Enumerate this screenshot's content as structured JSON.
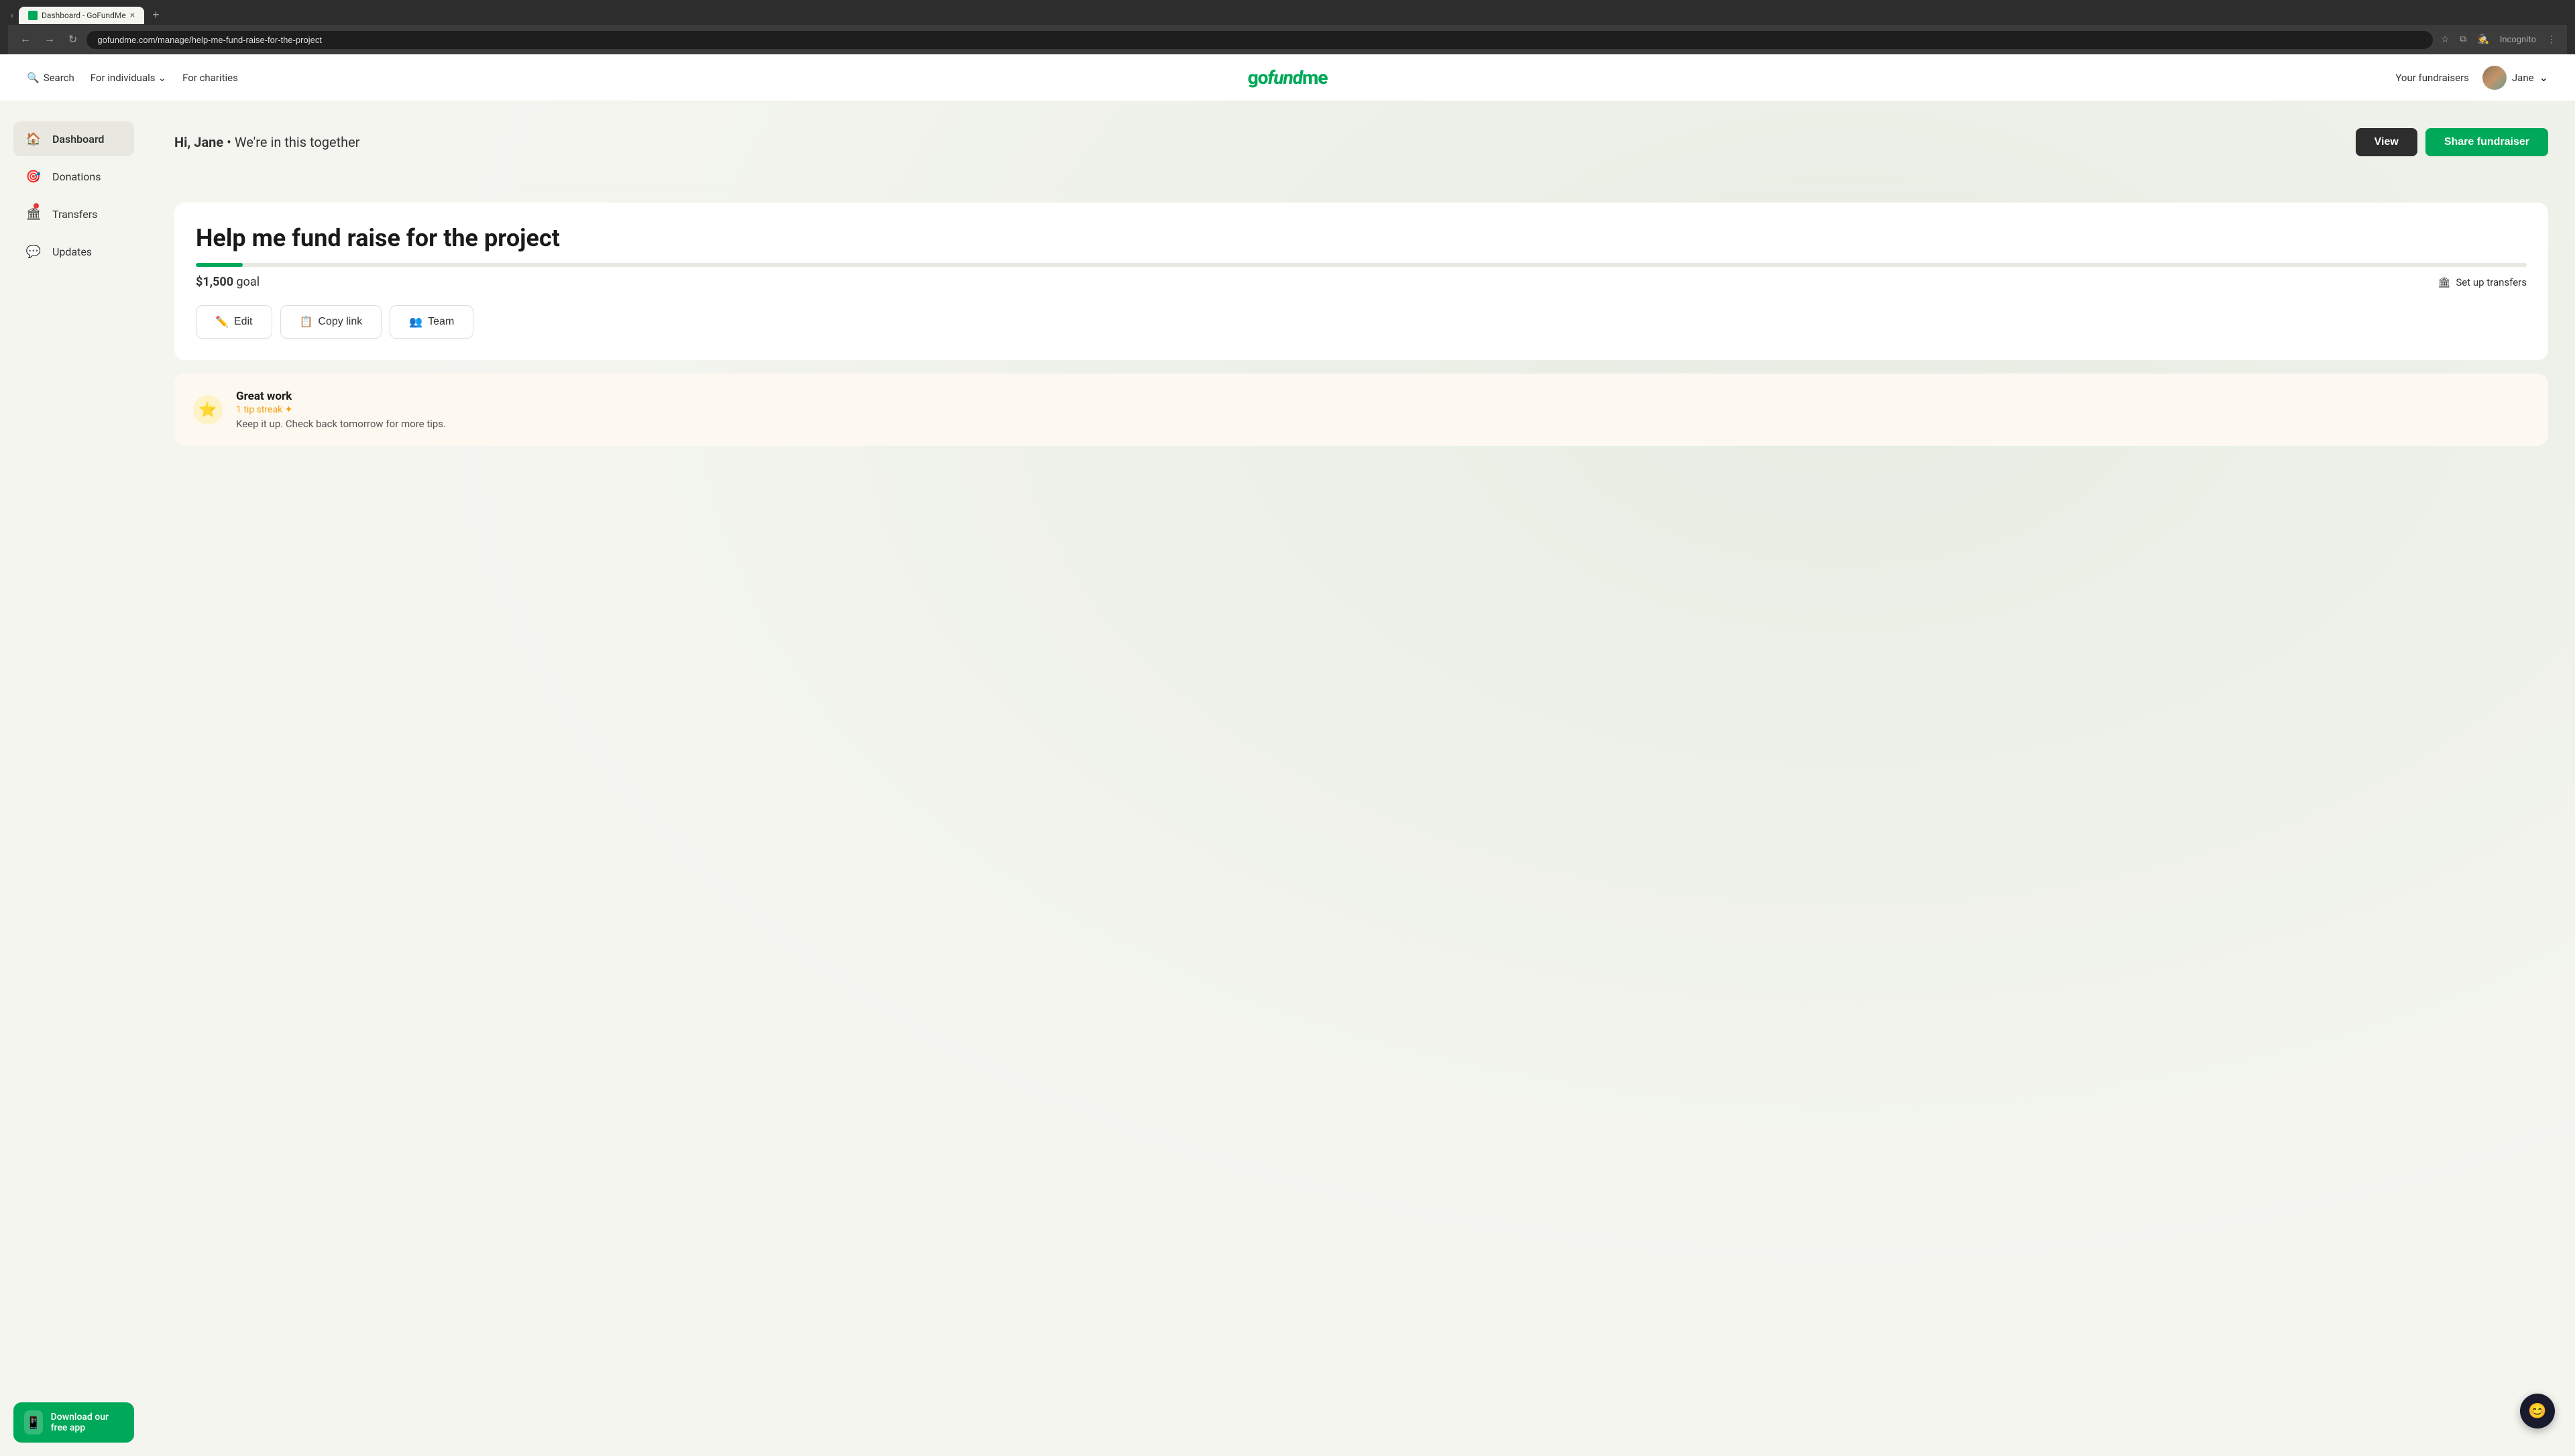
{
  "browser": {
    "tab_title": "Dashboard - GoFundMe",
    "url": "gofundme.com/manage/help-me-fund-raise-for-the-project",
    "incognito_label": "Incognito"
  },
  "nav": {
    "search_label": "Search",
    "for_individuals_label": "For individuals",
    "for_charities_label": "For charities",
    "logo_text": "gofundme",
    "your_fundraisers_label": "Your fundraisers",
    "username": "Jane"
  },
  "sidebar": {
    "items": [
      {
        "id": "dashboard",
        "label": "Dashboard",
        "icon": "🏠",
        "active": true,
        "badge": false
      },
      {
        "id": "donations",
        "label": "Donations",
        "icon": "🎯",
        "active": false,
        "badge": false
      },
      {
        "id": "transfers",
        "label": "Transfers",
        "icon": "🏛",
        "active": false,
        "badge": true
      },
      {
        "id": "updates",
        "label": "Updates",
        "icon": "💬",
        "active": false,
        "badge": false
      }
    ],
    "download_app_label": "Download our free app"
  },
  "dashboard": {
    "greeting": "Hi, Jane",
    "subtitle": "We're in this together",
    "view_button": "View",
    "share_button": "Share fundraiser"
  },
  "fundraiser": {
    "title": "Help me fund raise for the project",
    "goal_amount": "$1,500",
    "goal_label": "goal",
    "progress_percent": 2,
    "setup_transfers_label": "Set up transfers",
    "edit_label": "Edit",
    "copy_link_label": "Copy link",
    "team_label": "Team"
  },
  "tips": {
    "title": "Great work",
    "streak_label": "1 tip streak ✦",
    "message": "Keep it up. Check back tomorrow for more tips."
  },
  "chat": {
    "icon": "😊"
  }
}
